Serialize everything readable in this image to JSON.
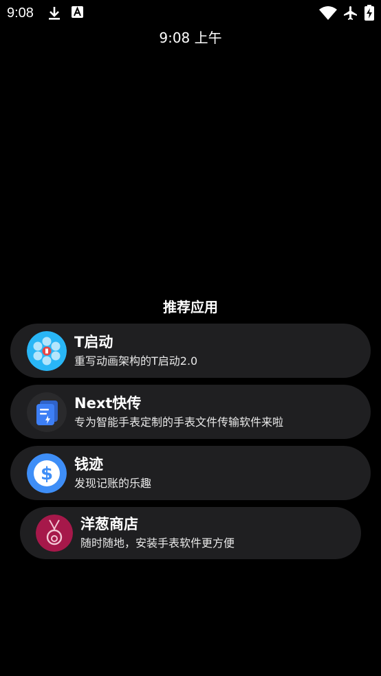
{
  "status_bar": {
    "time": "9:08",
    "icons": [
      "download-icon",
      "a-badge-icon",
      "wifi-icon",
      "airplane-icon",
      "battery-charging-icon"
    ]
  },
  "clock": {
    "text": "9:08 上午"
  },
  "recommended": {
    "title": "推荐应用",
    "apps": [
      {
        "name": "T启动",
        "desc": "重写动画架构的T启动2.0",
        "icon": "t-launcher-icon",
        "color": "#29b6f6"
      },
      {
        "name": "Next快传",
        "desc": "专为智能手表定制的手表文件传输软件来啦",
        "icon": "file-transfer-icon",
        "color": "#3d7ff5"
      },
      {
        "name": "钱迹",
        "desc": "发现记账的乐趣",
        "icon": "dollar-icon",
        "color": "#3e8ef7"
      },
      {
        "name": "洋葱商店",
        "desc": "随时随地，安装手表软件更方便",
        "icon": "onion-icon",
        "color": "#a6184a"
      }
    ]
  },
  "colors": {
    "background": "#000000",
    "card": "#1f1f21",
    "text": "#ffffff"
  }
}
